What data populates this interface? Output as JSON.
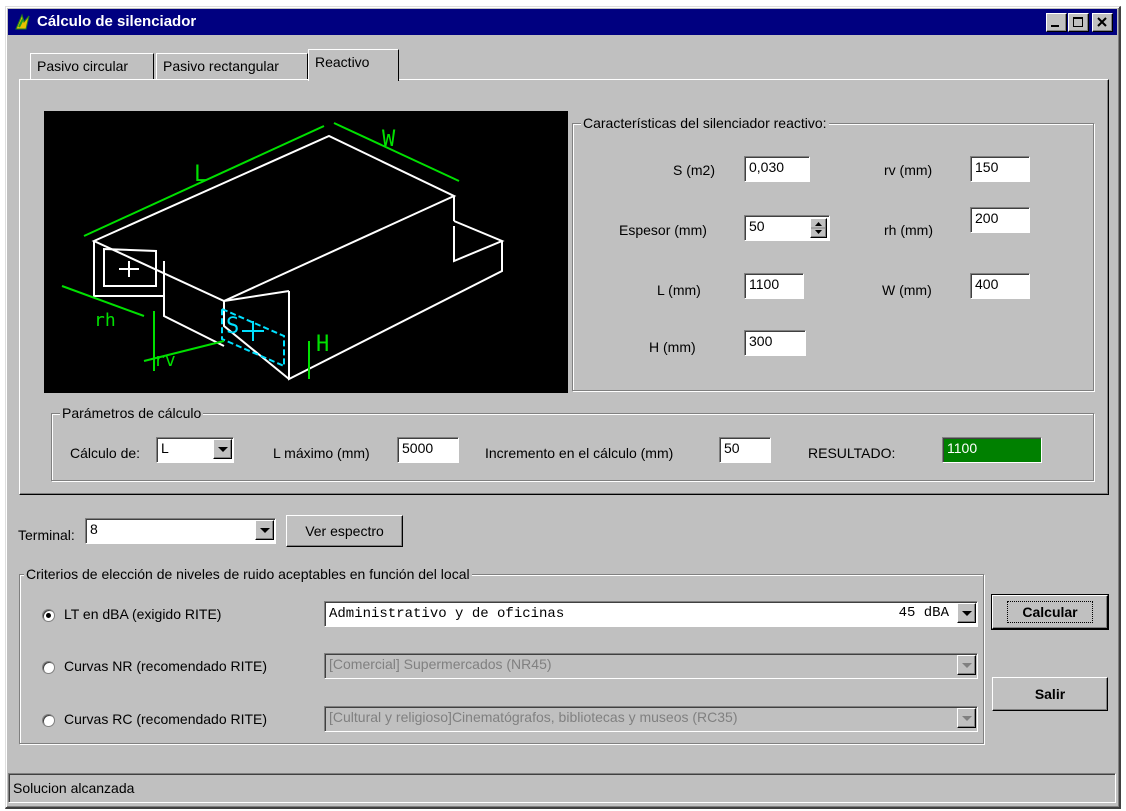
{
  "window": {
    "title": "Cálculo de silenciador",
    "controls": {
      "minimize": "_",
      "maximize": "□",
      "close": "×"
    }
  },
  "tabs": [
    {
      "label": "Pasivo circular",
      "active": false
    },
    {
      "label": "Pasivo rectangular",
      "active": false
    },
    {
      "label": "Reactivo",
      "active": true
    }
  ],
  "diagram": {
    "labels": {
      "L": "L",
      "W": "W",
      "H": "H",
      "S": "S",
      "rh": "rh",
      "rv": "rv"
    },
    "colors": {
      "background": "#000000",
      "box": "#ffffff",
      "dimension": "#00ff00",
      "section": "#00ffff"
    }
  },
  "characteristics": {
    "legend": "Características del silenciador reactivo:",
    "S_label": "S (m2)",
    "S_value": "0,030",
    "rv_label": "rv (mm)",
    "rv_value": "150",
    "espesor_label": "Espesor (mm)",
    "espesor_value": "50",
    "rh_label": "rh (mm)",
    "rh_value": "200",
    "L_label": "L (mm)",
    "L_value": "1100",
    "W_label": "W (mm)",
    "W_value": "400",
    "H_label": "H (mm)",
    "H_value": "300"
  },
  "params": {
    "legend": "Parámetros de cálculo",
    "calculo_label": "Cálculo de:",
    "calculo_value": "L",
    "lmax_label": "L máximo (mm)",
    "lmax_value": "5000",
    "incremento_label": "Incremento en el cálculo (mm)",
    "incremento_value": "50",
    "resultado_label": "RESULTADO:",
    "resultado_value": "1100",
    "resultado_color": "#008000"
  },
  "terminal": {
    "label": "Terminal:",
    "value": "8",
    "ver_espectro": "Ver espectro"
  },
  "criteria": {
    "legend": "Criterios de elección de niveles de ruido aceptables en función del local",
    "options": [
      {
        "label": "LT en dBA (exigido RITE)",
        "selected": true,
        "combo_value": "Administrativo y de oficinas",
        "combo_suffix": "45 dBA"
      },
      {
        "label": "Curvas NR (recomendado RITE)",
        "selected": false,
        "combo_value": "[Comercial] Supermercados (NR45)"
      },
      {
        "label": "Curvas RC (recomendado RITE)",
        "selected": false,
        "combo_value": "[Cultural y religioso]Cinematógrafos, bibliotecas y museos (RC35)"
      }
    ]
  },
  "buttons": {
    "calcular": "Calcular",
    "salir": "Salir"
  },
  "status": {
    "text": "Solucion alcanzada"
  }
}
